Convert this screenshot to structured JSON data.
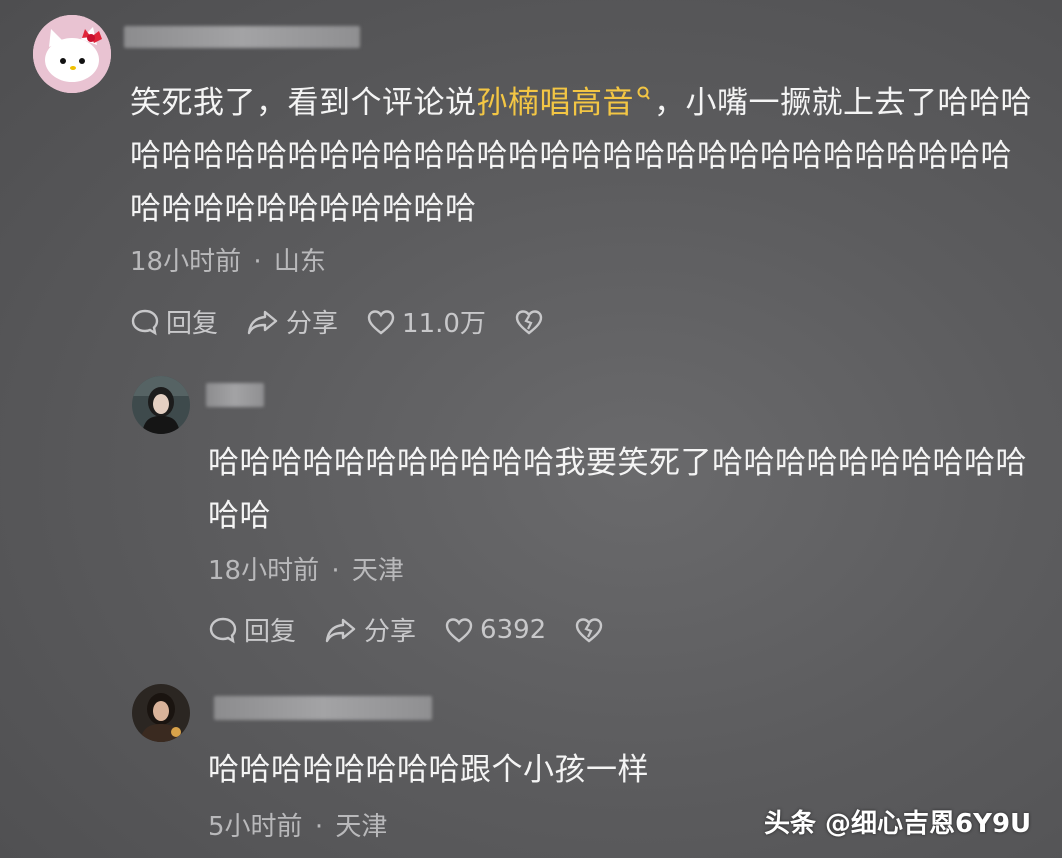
{
  "comments": [
    {
      "text_pre": "笑死我了，看到个评论说",
      "highlight": "孙楠唱高音",
      "text_post": "，小嘴一撅就上去了哈哈哈哈哈哈哈哈哈哈哈哈哈哈哈哈哈哈哈哈哈哈哈哈哈哈哈哈哈哈哈哈哈哈哈哈哈哈哈哈哈哈",
      "time": "18小时前",
      "location": "山东",
      "reply_label": "回复",
      "share_label": "分享",
      "likes": "11.0万"
    },
    {
      "text": "哈哈哈哈哈哈哈哈哈哈哈我要笑死了哈哈哈哈哈哈哈哈哈哈哈哈",
      "time": "18小时前",
      "location": "天津",
      "reply_label": "回复",
      "share_label": "分享",
      "likes": "6392"
    },
    {
      "text": "哈哈哈哈哈哈哈哈跟个小孩一样",
      "time": "5小时前",
      "location": "天津"
    }
  ],
  "separator": "·",
  "watermark": "头条 @细心吉恩6Y9U",
  "colors": {
    "highlight": "#f3c644",
    "background": "#5c5c5e"
  }
}
